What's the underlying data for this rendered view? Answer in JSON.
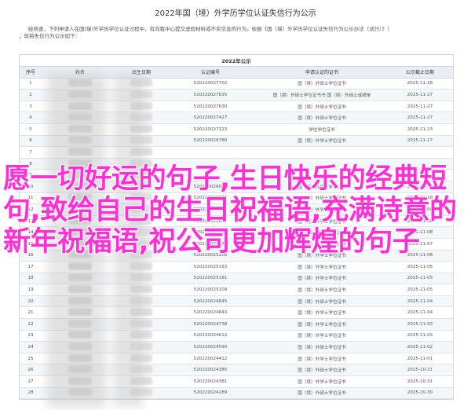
{
  "page": {
    "title": "2022年国（境）外学历学位认证失信行为公示"
  },
  "notice": {
    "line1": "经核查，下列申请人在国(境)外学历学位认证过程中，有向我中心提交虚假材料或不实信息的行为。依据《国（境）外学历学位认证失信行为公示办法（试行）》（",
    "line2": "，现将失信行为公示如下："
  },
  "table": {
    "year_label": "2022年公示",
    "headers": [
      "序号",
      "姓名",
      "出生日期",
      "认证编号",
      "申请认证的证书",
      "公示截止日期"
    ],
    "rows": [
      {
        "idx": "1",
        "id": "520220027702",
        "doc": "国（境）外硕士学位证书",
        "exp": "2025-11-28"
      },
      {
        "idx": "2",
        "id": "520220027635",
        "doc": "国（境）外硕士学位证书书 国（境）外硕士成绩单",
        "exp": "2025-11-27"
      },
      {
        "idx": "3",
        "id": "520220027630",
        "doc": "国（境）外硕士学位证书",
        "exp": "2025-11-27"
      },
      {
        "idx": "4",
        "id": "520220027427",
        "doc": "国（境）外硕士学位证书",
        "exp": "2025-11-27"
      },
      {
        "idx": "5",
        "id": "520220027123",
        "doc": "学位学位证书",
        "exp": "2025-11-23"
      },
      {
        "idx": "6",
        "id": "520220026780",
        "doc": "国（境）外学士学位证书",
        "exp": "2025-11-17"
      },
      {
        "idx": "7",
        "id": "",
        "doc": "",
        "exp": ""
      },
      {
        "idx": "8",
        "id": "",
        "doc": "",
        "exp": ""
      },
      {
        "idx": "9",
        "id": "",
        "doc": "",
        "exp": ""
      },
      {
        "idx": "10",
        "id": "520220026018",
        "doc": "国（境）外硕士学位证书",
        "exp": "2025-11-12"
      },
      {
        "idx": "11",
        "id": "520220025877",
        "doc": "国（境）外硕士学位证书",
        "exp": "2025-11-10"
      },
      {
        "idx": "12",
        "id": "520220025703",
        "doc": "国（境）外学士学位证书",
        "exp": "2025-11-08"
      },
      {
        "idx": "13",
        "id": "520220025665",
        "doc": "国（境）外学士学位证书",
        "exp": "2025-11-08"
      },
      {
        "idx": "14",
        "id": "520220025602",
        "doc": "国（境）外硕士学位证书",
        "exp": "2025-11-08"
      },
      {
        "idx": "15",
        "id": "520220025473",
        "doc": "国（境）外硕士学位证书",
        "exp": "2025-11-07"
      },
      {
        "idx": "16",
        "id": "520220025206",
        "doc": "国（境）外学士学位证书",
        "exp": "2025-11-06"
      },
      {
        "idx": "17",
        "id": "520220025183",
        "doc": "国（境）外学士学位证书",
        "exp": "2025-11-05"
      },
      {
        "idx": "18",
        "id": "520220025181",
        "doc": "国（境）外学士学位证书",
        "exp": "2025-11-05"
      },
      {
        "idx": "19",
        "id": "520220025109",
        "doc": "国（境）外硕士学位证书",
        "exp": "2025-11-05"
      },
      {
        "idx": "20",
        "id": "520220024845",
        "doc": "国（境）外硕士学位证书",
        "exp": "2025-11-04"
      },
      {
        "idx": "21",
        "id": "520220024843",
        "doc": "国（境）外学士学位证书",
        "exp": "2025-11-04"
      },
      {
        "idx": "22",
        "id": "520220024738",
        "doc": "国（境）外学士学位证书",
        "exp": "2025-11-03"
      },
      {
        "idx": "23",
        "id": "520220024612",
        "doc": "国（境）外学士学位证书",
        "exp": "2025-11-03"
      },
      {
        "idx": "24",
        "id": "520220024590",
        "doc": "国（境）外硕士学位证书",
        "exp": "2025-11-02"
      },
      {
        "idx": "25",
        "id": "520220024412",
        "doc": "国（境）外学士学位证书",
        "exp": "2025-11-01"
      },
      {
        "idx": "26",
        "id": "520220024385",
        "doc": "国（境）外硕士学位证书",
        "exp": "2025-10-31"
      },
      {
        "idx": "27",
        "id": "520220024381",
        "doc": "国（境）外学士学位证书",
        "exp": "2025-10-31"
      },
      {
        "idx": "28",
        "id": "520220024289",
        "doc": "国（境）外硕士学位证书",
        "exp": "2025-10-30"
      }
    ]
  },
  "overlay": {
    "text": "愿一切好运的句子,生日快乐的经典短句,致给自己的生日祝福语,充满诗意的新年祝福语,祝公司更加辉煌的句子"
  }
}
